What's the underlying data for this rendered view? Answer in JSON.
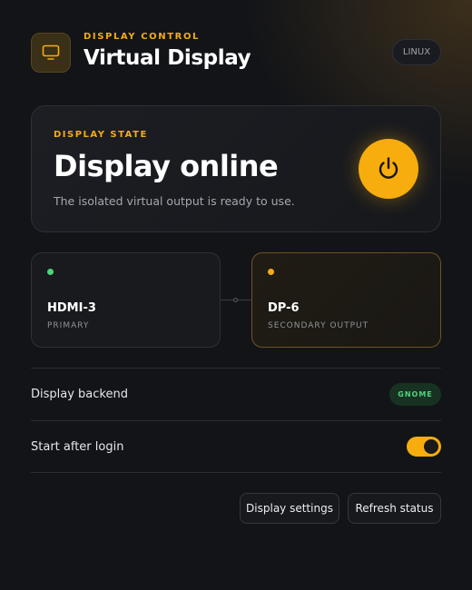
{
  "header": {
    "eyebrow": "DISPLAY CONTROL",
    "title": "Virtual Display",
    "os_badge": "LINUX",
    "icon": "monitor-icon"
  },
  "state": {
    "eyebrow": "DISPLAY STATE",
    "title": "Display online",
    "description": "The isolated virtual output is ready to use.",
    "power_icon": "power-icon"
  },
  "outputs": [
    {
      "name": "HDMI-3",
      "role": "PRIMARY",
      "status_color": "#4cd47a"
    },
    {
      "name": "DP-6",
      "role": "SECONDARY OUTPUT",
      "status_color": "#f4ac14"
    }
  ],
  "settings": {
    "backend_label": "Display backend",
    "backend_value": "GNOME",
    "autostart_label": "Start after login",
    "autostart_enabled": true
  },
  "actions": {
    "display_settings": "Display settings",
    "refresh_status": "Refresh status"
  },
  "colors": {
    "accent": "#f4ac14",
    "success": "#4cd47a",
    "background": "#121418"
  }
}
